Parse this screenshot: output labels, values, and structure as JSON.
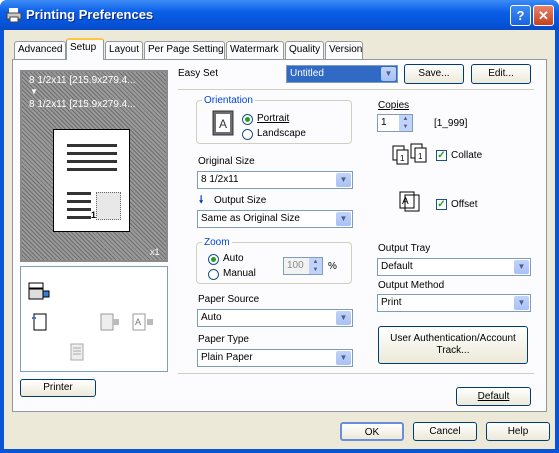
{
  "window": {
    "title": "Printing Preferences"
  },
  "tabs": [
    "Advanced",
    "Setup",
    "Layout",
    "Per Page Setting",
    "Watermark",
    "Quality",
    "Version"
  ],
  "active_tab": "Setup",
  "preview": {
    "line1": "8 1/2x11 [215.9x279.4...",
    "arrow": "▼",
    "line2": "8 1/2x11 [215.9x279.4...",
    "copies_badge": "x1",
    "page_number": "1"
  },
  "easy_set": {
    "label": "Easy Set",
    "value": "Untitled",
    "save_label": "Save...",
    "edit_label": "Edit..."
  },
  "orientation": {
    "title": "Orientation",
    "portrait": "Portrait",
    "landscape": "Landscape",
    "selected": "Portrait"
  },
  "original_size": {
    "label": "Original Size",
    "value": "8 1/2x11"
  },
  "output_size": {
    "label": "Output Size",
    "value": "Same as Original Size"
  },
  "zoom": {
    "title": "Zoom",
    "auto": "Auto",
    "manual": "Manual",
    "value": "100",
    "unit": "%"
  },
  "paper_source": {
    "label": "Paper Source",
    "value": "Auto"
  },
  "paper_type": {
    "label": "Paper Type",
    "value": "Plain Paper"
  },
  "copies": {
    "label": "Copies",
    "value": "1",
    "range": "[1_999]"
  },
  "collate": {
    "label": "Collate",
    "checked": true
  },
  "offset": {
    "label": "Offset",
    "checked": true
  },
  "output_tray": {
    "label": "Output Tray",
    "value": "Default"
  },
  "output_method": {
    "label": "Output Method",
    "value": "Print"
  },
  "auth_button": {
    "line1": "User Authentication/Account",
    "line2": "Track..."
  },
  "printer_button": "Printer",
  "default_button": "Default",
  "footer": {
    "ok": "OK",
    "cancel": "Cancel",
    "help": "Help"
  }
}
